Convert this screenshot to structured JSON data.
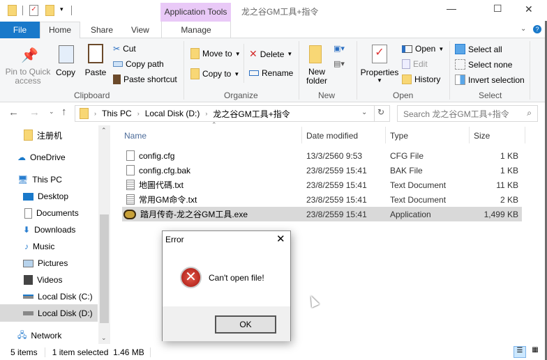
{
  "window": {
    "title": "龙之谷GM工具+指令",
    "context_tab": "Application Tools",
    "minimize": "—",
    "maximize": "☐",
    "close": "✕"
  },
  "tabs": [
    {
      "label": "File"
    },
    {
      "label": "Home"
    },
    {
      "label": "Share"
    },
    {
      "label": "View"
    },
    {
      "label": "Manage"
    }
  ],
  "ribbon": {
    "clipboard": {
      "group": "Clipboard",
      "pin": "Pin to Quick access",
      "copy": "Copy",
      "paste": "Paste",
      "cut": "Cut",
      "copy_path": "Copy path",
      "paste_shortcut": "Paste shortcut"
    },
    "organize": {
      "group": "Organize",
      "move_to": "Move to",
      "copy_to": "Copy to",
      "delete": "Delete",
      "rename": "Rename"
    },
    "new": {
      "group": "New",
      "new_folder": "New folder"
    },
    "open": {
      "group": "Open",
      "properties": "Properties",
      "open": "Open",
      "edit": "Edit",
      "history": "History"
    },
    "select": {
      "group": "Select",
      "select_all": "Select all",
      "select_none": "Select none",
      "invert": "Invert selection"
    }
  },
  "address": {
    "crumbs": [
      "This PC",
      "Local Disk (D:)",
      "龙之谷GM工具+指令"
    ],
    "search_placeholder": "Search 龙之谷GM工具+指令"
  },
  "sidebar": {
    "items": [
      {
        "label": "注册机"
      },
      {
        "label": "OneDrive"
      },
      {
        "label": "This PC"
      },
      {
        "label": "Desktop"
      },
      {
        "label": "Documents"
      },
      {
        "label": "Downloads"
      },
      {
        "label": "Music"
      },
      {
        "label": "Pictures"
      },
      {
        "label": "Videos"
      },
      {
        "label": "Local Disk (C:)"
      },
      {
        "label": "Local Disk (D:)"
      },
      {
        "label": "Network"
      }
    ]
  },
  "columns": {
    "name": "Name",
    "date": "Date modified",
    "type": "Type",
    "size": "Size"
  },
  "files": [
    {
      "name": "config.cfg",
      "date": "13/3/2560 9:53",
      "type": "CFG File",
      "size": "1 KB"
    },
    {
      "name": "config.cfg.bak",
      "date": "23/8/2559 15:41",
      "type": "BAK File",
      "size": "1 KB"
    },
    {
      "name": "地圖代碼.txt",
      "date": "23/8/2559 15:41",
      "type": "Text Document",
      "size": "11 KB"
    },
    {
      "name": "常用GM命令.txt",
      "date": "23/8/2559 15:41",
      "type": "Text Document",
      "size": "2 KB"
    },
    {
      "name": "踏月传奇-龙之谷GM工具.exe",
      "date": "23/8/2559 15:41",
      "type": "Application",
      "size": "1,499 KB"
    }
  ],
  "status": {
    "items": "5 items",
    "selected": "1 item selected  1.46 MB"
  },
  "dialog": {
    "title": "Error",
    "message": "Can't open file!",
    "ok": "OK"
  },
  "colors": {
    "file_tab": "#1979ca",
    "context_tab": "#e9c9f7",
    "selected_row": "#d9d9d9",
    "ribbon_bg": "#f5f6f7"
  }
}
